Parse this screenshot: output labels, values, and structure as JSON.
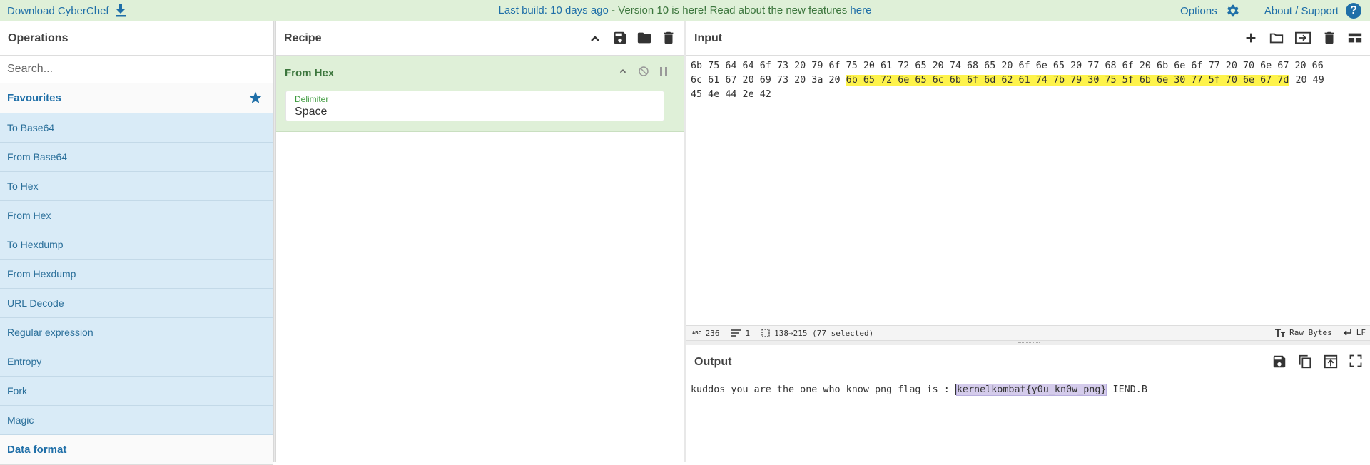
{
  "banner": {
    "download_label": "Download CyberChef",
    "build_text": "Last build: 10 days ago",
    "version_msg": " - Version 10 is here! Read about the new features ",
    "here_link": "here",
    "options_label": "Options",
    "about_label": "About / Support"
  },
  "operations": {
    "title": "Operations",
    "search_placeholder": "Search...",
    "favourites_label": "Favourites",
    "items": [
      "To Base64",
      "From Base64",
      "To Hex",
      "From Hex",
      "To Hexdump",
      "From Hexdump",
      "URL Decode",
      "Regular expression",
      "Entropy",
      "Fork",
      "Magic"
    ],
    "next_category": "Data format"
  },
  "recipe": {
    "title": "Recipe",
    "op_name": "From Hex",
    "arg_label": "Delimiter",
    "arg_value": "Space"
  },
  "input": {
    "title": "Input",
    "line1": "6b 75 64 64 6f 73 20 79 6f 75 20 61 72 65 20 74 68 65 20 6f 6e 65 20 77 68 6f 20 6b 6e 6f 77 20 70 6e 67 20 66",
    "line2_pre": "6c 61 67 20 69 73 20 3a 20 ",
    "line2_hl": "6b 65 72 6e 65 6c 6b 6f 6d 62 61 74 7b 79 30 75 5f 6b 6e 30 77 5f 70 6e 67 7d",
    "line2_post": " 20 49",
    "line3": "45 4e 44 2e 42"
  },
  "status": {
    "length": "236",
    "lines": "1",
    "selection": "138→215 (77 selected)",
    "encoding": "Raw Bytes",
    "eol": "LF"
  },
  "output": {
    "title": "Output",
    "text_pre": "kuddos you are the one who know png flag is : ",
    "text_sel": "kernelkombat{y0u_kn0w_png}",
    "text_post": " IEND.B"
  },
  "colors": {
    "banner_bg": "#dff0d8",
    "link_blue": "#1f6fa8",
    "op_item_bg": "#d9ebf7",
    "recipe_op_bg": "#dff0d8",
    "highlight_yellow": "#fef34b",
    "selection_purple": "#d4cbeb"
  }
}
